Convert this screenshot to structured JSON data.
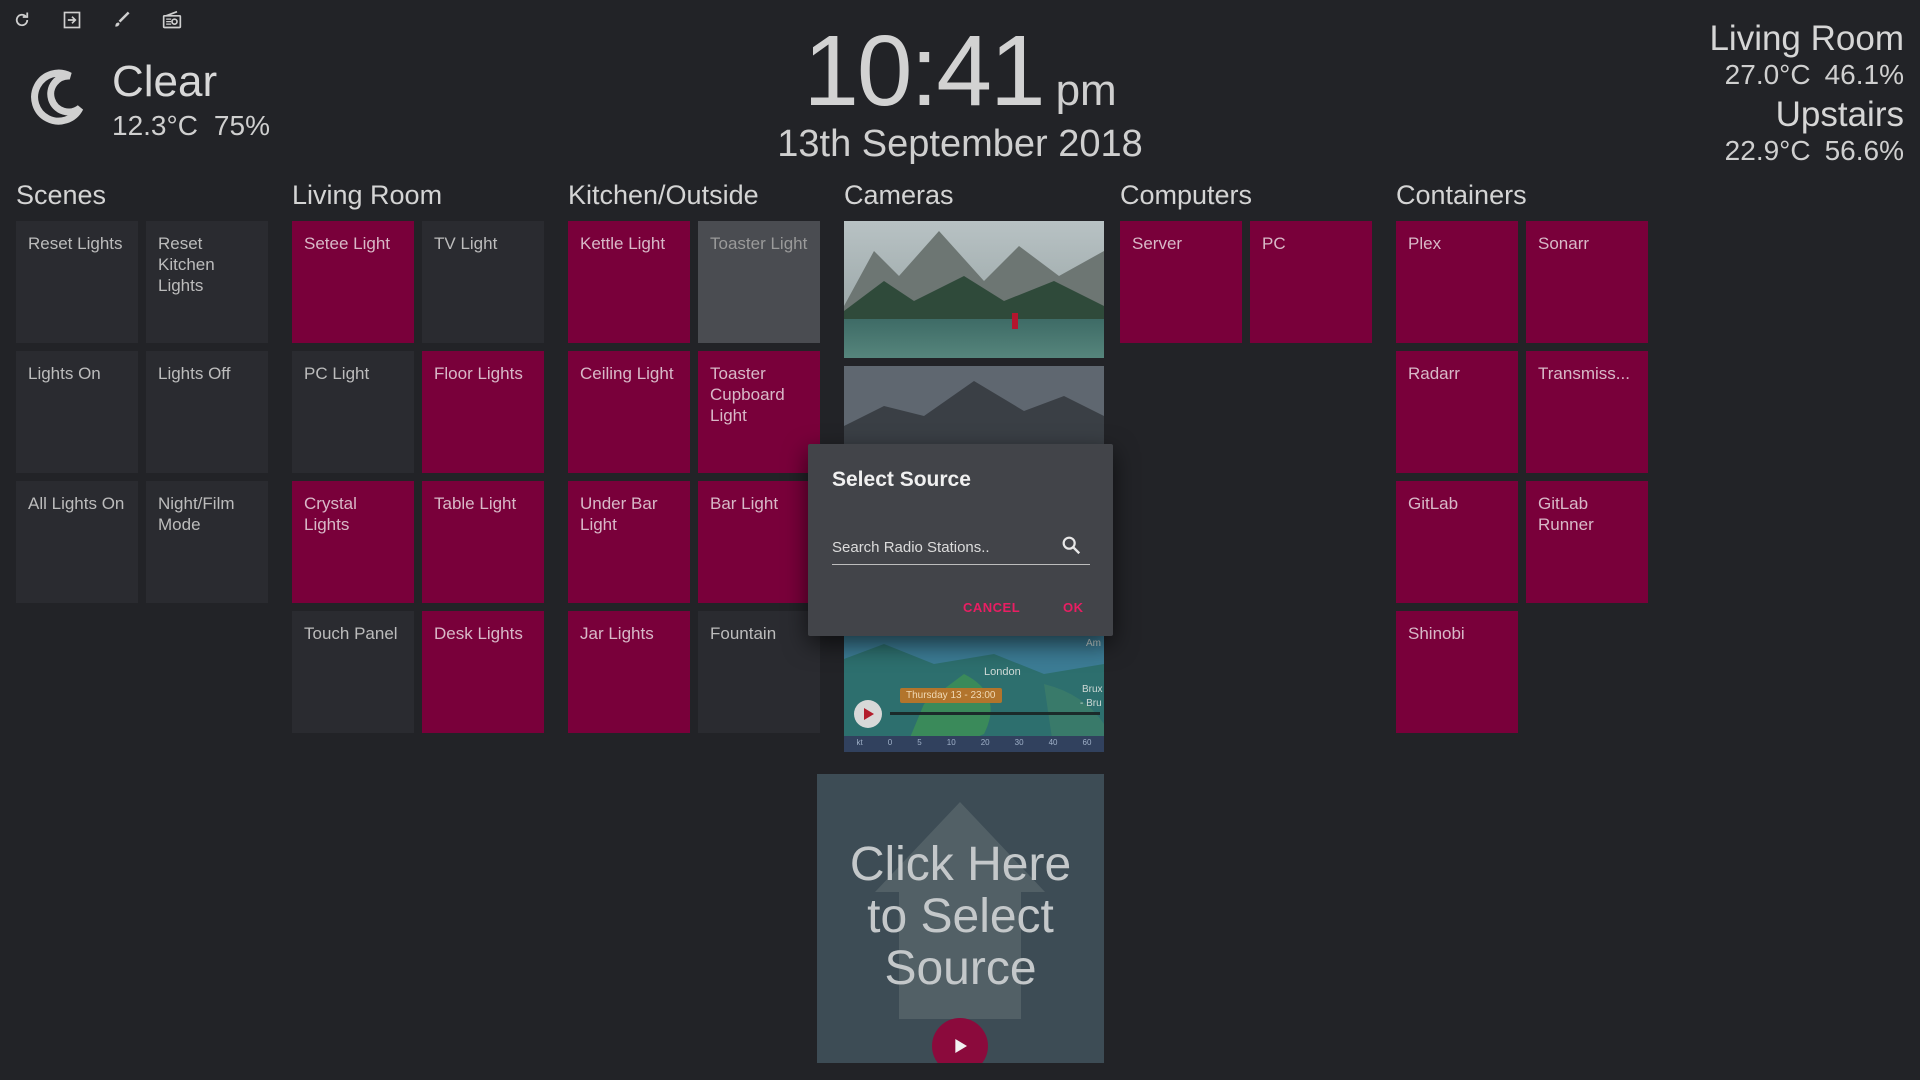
{
  "toolbar": {
    "icons": [
      "refresh-icon",
      "login-icon",
      "brush-icon",
      "radio-icon"
    ]
  },
  "weather": {
    "condition": "Clear",
    "temperature": "12.3°C",
    "humidity": "75%"
  },
  "clock": {
    "time": "10:41",
    "ampm": "pm",
    "date": "13th September 2018"
  },
  "sensors": [
    {
      "name": "Living Room",
      "temperature": "27.0°C",
      "humidity": "46.1%"
    },
    {
      "name": "Upstairs",
      "temperature": "22.9°C",
      "humidity": "56.6%"
    }
  ],
  "groups": {
    "scenes": {
      "title": "Scenes",
      "tiles": [
        "Reset Lights",
        "Reset Kitchen Lights",
        "Lights On",
        "Lights Off",
        "All Lights On",
        "Night/Film Mode"
      ]
    },
    "living_room": {
      "title": "Living Room",
      "tiles": [
        "Setee Light",
        "TV Light",
        "PC Light",
        "Floor Lights",
        "Crystal Lights",
        "Table Light",
        "Touch Panel",
        "Desk Lights"
      ]
    },
    "kitchen": {
      "title": "Kitchen/Outside",
      "tiles": [
        "Kettle Light",
        "Toaster Light",
        "Ceiling Light",
        "Toaster Cupboard Light",
        "Under Bar Light",
        "Bar Light",
        "Jar Lights",
        "Fountain"
      ]
    },
    "cameras": {
      "title": "Cameras"
    },
    "computers": {
      "title": "Computers",
      "tiles": [
        "Server",
        "PC"
      ]
    },
    "containers": {
      "title": "Containers",
      "tiles": [
        "Plex",
        "Sonarr",
        "Radarr",
        "Transmiss...",
        "GitLab",
        "GitLab Runner",
        "Shinobi"
      ]
    }
  },
  "map": {
    "city": "London",
    "timestamp": "Thursday 13 - 23:00",
    "city_short_1": "Am",
    "city_short_2": "Brux",
    "city_short_3": "- Bru",
    "scale": [
      "kt",
      "0",
      "5",
      "10",
      "20",
      "30",
      "40",
      "60"
    ]
  },
  "radio": {
    "line1": "Click Here",
    "line2": "to Select",
    "line3": "Source"
  },
  "dialog": {
    "title": "Select Source",
    "placeholder": "Search Radio Stations..",
    "cancel": "CANCEL",
    "ok": "OK"
  },
  "colors": {
    "background": "#222327",
    "tile_off": "#2a2b30",
    "tile_on": "#79003a",
    "accent": "#e91e63"
  }
}
